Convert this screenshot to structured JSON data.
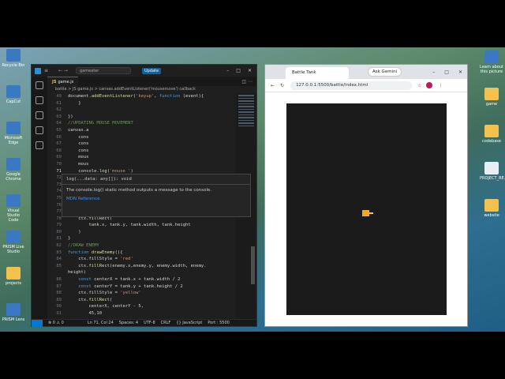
{
  "desktop_left": [
    {
      "label": "Recycle Bin",
      "kind": "bin"
    },
    {
      "label": "CapCut",
      "kind": "app"
    },
    {
      "label": "Microsoft Edge",
      "kind": "app"
    },
    {
      "label": "Google Chrome",
      "kind": "app"
    },
    {
      "label": "Visual Studio Code",
      "kind": "app"
    },
    {
      "label": "PRISM Live Studio",
      "kind": "app"
    },
    {
      "label": "projects",
      "kind": "folder"
    },
    {
      "label": "PRISM Lens",
      "kind": "app"
    }
  ],
  "desktop_right": [
    {
      "label": "Learn about this picture",
      "kind": "app"
    },
    {
      "label": "game",
      "kind": "folder"
    },
    {
      "label": "codebase",
      "kind": "folder"
    },
    {
      "label": "PROJECT_RE...",
      "kind": "file"
    },
    {
      "label": "website",
      "kind": "folder"
    }
  ],
  "vscode": {
    "search_text": "gameater",
    "update_label": "Update",
    "tab_label": "game.js",
    "breadcrumb": "battle > JS game.js > canvas.addEventListener('mousemove') callback",
    "tooltip": {
      "signature": "log(...data: any[]): void",
      "description": "The console.log() static method outputs a message to the console.",
      "link": "MDN Reference"
    },
    "lines": [
      {
        "n": "49",
        "text": "document.addEventListener('keyup', function (event){"
      },
      {
        "n": "61",
        "text": "    }"
      },
      {
        "n": "62",
        "text": ""
      },
      {
        "n": "63",
        "text": "})"
      },
      {
        "n": "64",
        "text": "//UPDATING MOUSE MOVEMENT"
      },
      {
        "n": "65",
        "text": "canvas.a"
      },
      {
        "n": "66",
        "text": "    cons"
      },
      {
        "n": "67",
        "text": "    cons"
      },
      {
        "n": "68",
        "text": "    cons"
      },
      {
        "n": "69",
        "text": "    mous"
      },
      {
        "n": "70",
        "text": "    mous"
      },
      {
        "n": "71",
        "text": "    console.log('mouse ')"
      },
      {
        "n": "72",
        "text": "})"
      },
      {
        "n": "73",
        "text": ""
      },
      {
        "n": "74",
        "text": ""
      },
      {
        "n": "75",
        "text": "//DRAW TANK"
      },
      {
        "n": "76",
        "text": "function drawTank(){"
      },
      {
        "n": "77",
        "text": "    ctx.fillStyle = 'orange'"
      },
      {
        "n": "78",
        "text": "    ctx.fillRect("
      },
      {
        "n": "79",
        "text": "        tank.x, tank.y, tank.width, tank.height"
      },
      {
        "n": "80",
        "text": "    )"
      },
      {
        "n": "81",
        "text": "}"
      },
      {
        "n": "82",
        "text": "//DRAW ENEMY"
      },
      {
        "n": "83",
        "text": "function drawEnemy(){"
      },
      {
        "n": "84",
        "text": "    ctx.fillStyle = 'red'"
      },
      {
        "n": "85",
        "text": "    ctx.fillRect(enemy.x,enemy.y, enemy.width, enemy."
      },
      {
        "n": "",
        "text": "height)"
      },
      {
        "n": "86",
        "text": "    const centerX = tank.x + tank.width / 2"
      },
      {
        "n": "87",
        "text": "    const centerY = tank.y + tank.height / 2"
      },
      {
        "n": "88",
        "text": "    ctx.fillStyle = 'yellow'"
      },
      {
        "n": "89",
        "text": "    ctx.fillRect("
      },
      {
        "n": "90",
        "text": "        centerX, centerY - 5,"
      },
      {
        "n": "91",
        "text": "        45,10"
      }
    ],
    "status": {
      "errors": "⊗ 0 ⚠ 0",
      "position": "Ln 71, Col 24",
      "spaces": "Spaces: 4",
      "encoding": "UTF-8",
      "eol": "CRLF",
      "language": "{} JavaScript",
      "port": "Port : 5500"
    }
  },
  "browser": {
    "tab_title": "Battle Tank",
    "gemini_label": "Ask Gemini",
    "url": "127.0.0.1:5500/battle/index.html"
  }
}
